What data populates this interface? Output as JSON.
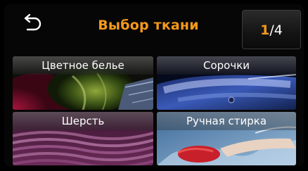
{
  "header": {
    "title": "Выбор ткани",
    "back_icon": "back-arrow-icon",
    "page_current": "1",
    "page_sep": "/",
    "page_total": "4"
  },
  "colors": {
    "accent": "#f59a1c",
    "background": "#000000",
    "text": "#ffffff"
  },
  "fabrics": [
    {
      "label": "Цветное белье"
    },
    {
      "label": "Сорочки"
    },
    {
      "label": "Шерсть"
    },
    {
      "label": "Ручная стирка"
    }
  ]
}
